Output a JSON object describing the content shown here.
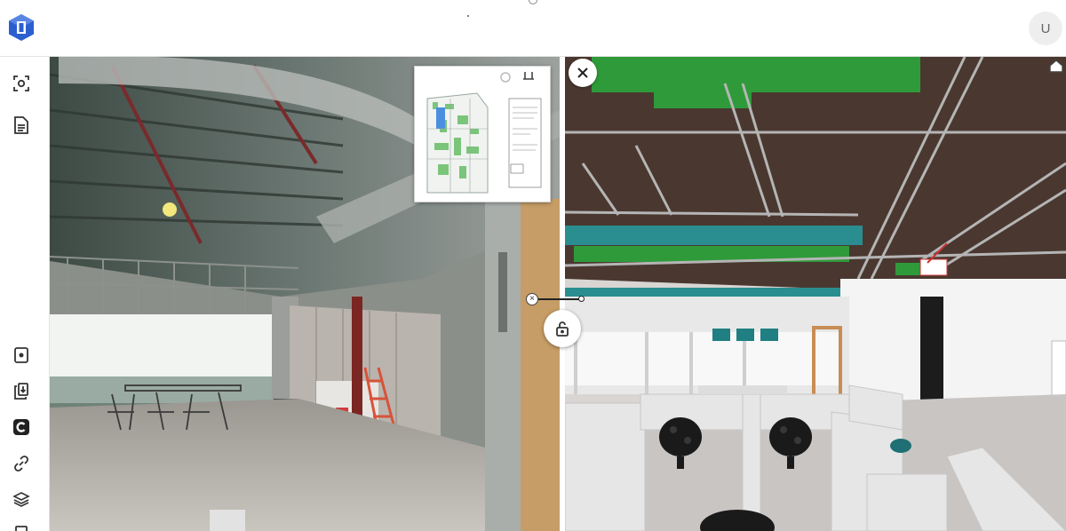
{
  "header": {
    "avatar_initial": "U"
  },
  "sidebar": {
    "items": [
      {
        "icon": "capture-icon"
      },
      {
        "icon": "document-icon"
      },
      {
        "icon": "add-image-icon"
      },
      {
        "icon": "download-icon"
      },
      {
        "icon": "compare-icon"
      },
      {
        "icon": "link-icon"
      },
      {
        "icon": "layers-icon"
      }
    ]
  },
  "viewer": {
    "left_icons": [
      "rotate-icon",
      "expand-icon"
    ],
    "right_icons": [
      "close-icon",
      "home-icon"
    ],
    "split_icons": [
      "sync-handle-icon",
      "lock-icon"
    ]
  },
  "colors": {
    "brand": "#2b5fcf",
    "bim_green": "#2f9a3a",
    "bim_teal": "#2a8e91",
    "ceiling_brown": "#4a3830"
  }
}
